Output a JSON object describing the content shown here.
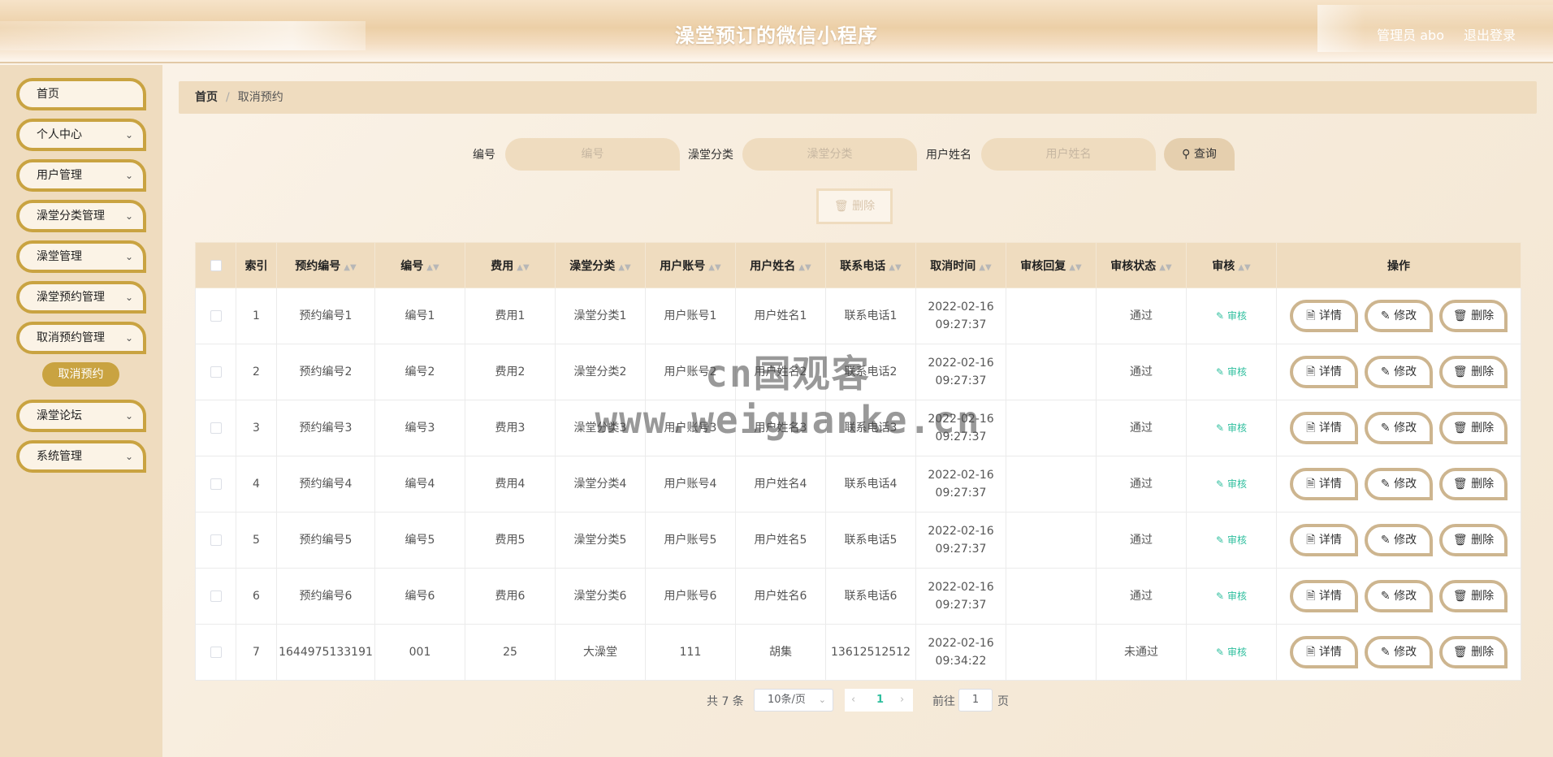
{
  "header": {
    "title": "澡堂预订的微信小程序",
    "user": "管理员 abo",
    "logout": "退出登录"
  },
  "sidebar": {
    "items": [
      {
        "label": "首页",
        "has_chevron": false
      },
      {
        "label": "个人中心",
        "has_chevron": true
      },
      {
        "label": "用户管理",
        "has_chevron": true
      },
      {
        "label": "澡堂分类管理",
        "has_chevron": true
      },
      {
        "label": "澡堂管理",
        "has_chevron": true
      },
      {
        "label": "澡堂预约管理",
        "has_chevron": true
      },
      {
        "label": "取消预约管理",
        "has_chevron": true
      },
      {
        "label": "澡堂论坛",
        "has_chevron": true
      },
      {
        "label": "系统管理",
        "has_chevron": true
      }
    ],
    "active_sub": "取消预约"
  },
  "breadcrumb": {
    "home": "首页",
    "current": "取消预约"
  },
  "search": {
    "fields": [
      {
        "label": "编号",
        "placeholder": "编号"
      },
      {
        "label": "澡堂分类",
        "placeholder": "澡堂分类"
      },
      {
        "label": "用户姓名",
        "placeholder": "用户姓名"
      }
    ],
    "button": "查询",
    "delete_button": "删除"
  },
  "table": {
    "columns": [
      "索引",
      "预约编号",
      "编号",
      "费用",
      "澡堂分类",
      "用户账号",
      "用户姓名",
      "联系电话",
      "取消时间",
      "审核回复",
      "审核状态",
      "审核",
      "操作"
    ],
    "rows": [
      {
        "index": "1",
        "booking_no": "预约编号1",
        "no": "编号1",
        "fee": "费用1",
        "category": "澡堂分类1",
        "account": "用户账号1",
        "name": "用户姓名1",
        "phone": "联系电话1",
        "date": "2022-02-16",
        "time": "09:27:37",
        "reply": "",
        "status": "通过"
      },
      {
        "index": "2",
        "booking_no": "预约编号2",
        "no": "编号2",
        "fee": "费用2",
        "category": "澡堂分类2",
        "account": "用户账号2",
        "name": "用户姓名2",
        "phone": "联系电话2",
        "date": "2022-02-16",
        "time": "09:27:37",
        "reply": "",
        "status": "通过"
      },
      {
        "index": "3",
        "booking_no": "预约编号3",
        "no": "编号3",
        "fee": "费用3",
        "category": "澡堂分类3",
        "account": "用户账号3",
        "name": "用户姓名3",
        "phone": "联系电话3",
        "date": "2022-02-16",
        "time": "09:27:37",
        "reply": "",
        "status": "通过"
      },
      {
        "index": "4",
        "booking_no": "预约编号4",
        "no": "编号4",
        "fee": "费用4",
        "category": "澡堂分类4",
        "account": "用户账号4",
        "name": "用户姓名4",
        "phone": "联系电话4",
        "date": "2022-02-16",
        "time": "09:27:37",
        "reply": "",
        "status": "通过"
      },
      {
        "index": "5",
        "booking_no": "预约编号5",
        "no": "编号5",
        "fee": "费用5",
        "category": "澡堂分类5",
        "account": "用户账号5",
        "name": "用户姓名5",
        "phone": "联系电话5",
        "date": "2022-02-16",
        "time": "09:27:37",
        "reply": "",
        "status": "通过"
      },
      {
        "index": "6",
        "booking_no": "预约编号6",
        "no": "编号6",
        "fee": "费用6",
        "category": "澡堂分类6",
        "account": "用户账号6",
        "name": "用户姓名6",
        "phone": "联系电话6",
        "date": "2022-02-16",
        "time": "09:27:37",
        "reply": "",
        "status": "通过"
      },
      {
        "index": "7",
        "booking_no": "1644975133191",
        "no": "001",
        "fee": "25",
        "category": "大澡堂",
        "account": "111",
        "name": "胡集",
        "phone": "13612512512",
        "date": "2022-02-16",
        "time": "09:34:22",
        "reply": "",
        "status": "未通过"
      }
    ],
    "audit_label": "审核",
    "actions": {
      "detail": "详情",
      "edit": "修改",
      "delete": "删除"
    }
  },
  "pagination": {
    "total": "共 7 条",
    "page_size": "10条/页",
    "current_page": "1",
    "goto_prefix": "前往",
    "goto_value": "1",
    "goto_suffix": "页"
  },
  "watermark": "cn国观客www.weiguanke.cn",
  "colors": {
    "accent_gold": "#c9a341",
    "panel_beige": "#efdcbf",
    "audit_green": "#2fbf9e"
  },
  "icons": {
    "chevron": "chevron-down-icon",
    "search": "search-icon",
    "trash": "trash-icon",
    "detail": "document-icon",
    "edit": "pencil-icon"
  }
}
